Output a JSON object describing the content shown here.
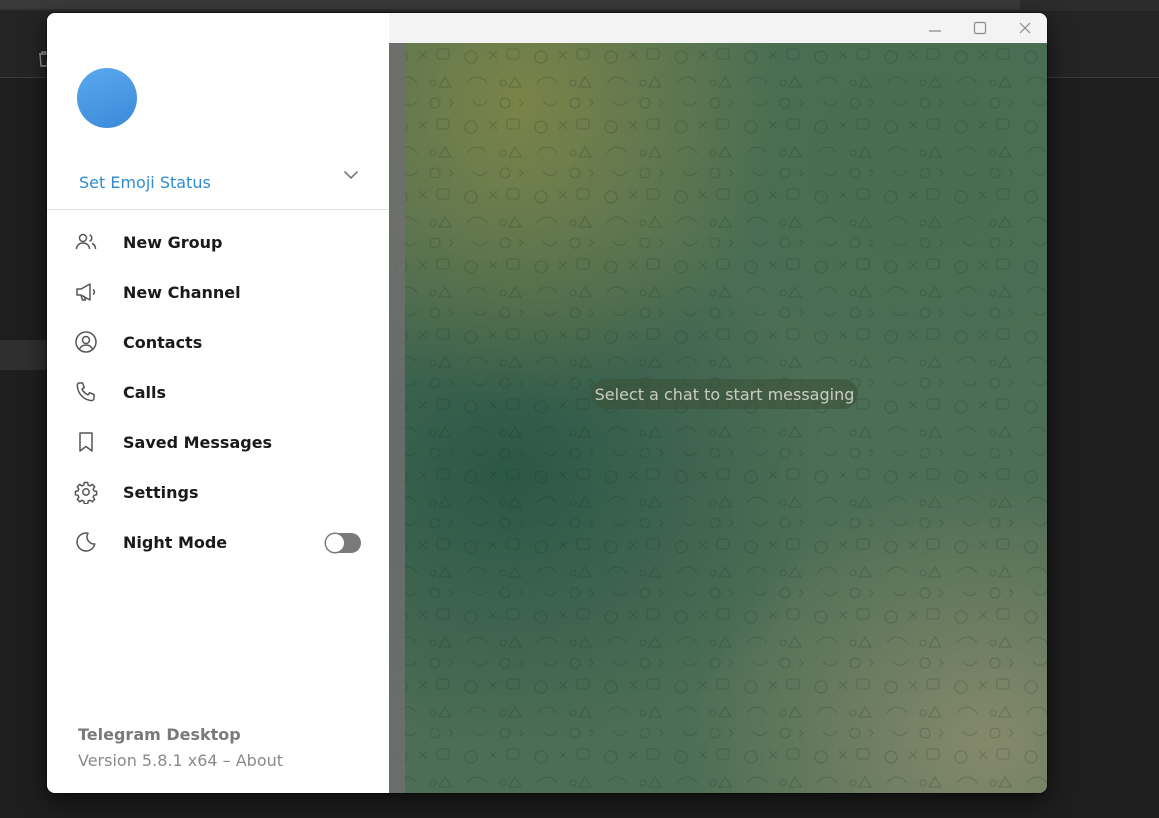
{
  "window": {
    "controls": {
      "minimize_icon": "minimize-icon",
      "maximize_icon": "maximize-icon",
      "close_icon": "close-icon"
    }
  },
  "profile": {
    "emoji_status": "Set Emoji Status",
    "avatar_color": "#4a9be6",
    "expand_icon": "chevron-down-icon"
  },
  "menu": {
    "items": [
      {
        "label": "New Group",
        "icon": "group-icon"
      },
      {
        "label": "New Channel",
        "icon": "megaphone-icon"
      },
      {
        "label": "Contacts",
        "icon": "contact-icon"
      },
      {
        "label": "Calls",
        "icon": "phone-icon"
      },
      {
        "label": "Saved Messages",
        "icon": "bookmark-icon"
      },
      {
        "label": "Settings",
        "icon": "gear-icon"
      },
      {
        "label": "Night Mode",
        "icon": "moon-icon",
        "toggle_on": false
      }
    ]
  },
  "chat": {
    "placeholder": "Select a chat to start messaging"
  },
  "footer": {
    "app_name": "Telegram Desktop",
    "version": "Version 5.8.1 x64 – About"
  },
  "colors": {
    "accent": "#2f8cd1",
    "menu_bg": "#ffffff",
    "chat_bg": "#4d6e55"
  }
}
